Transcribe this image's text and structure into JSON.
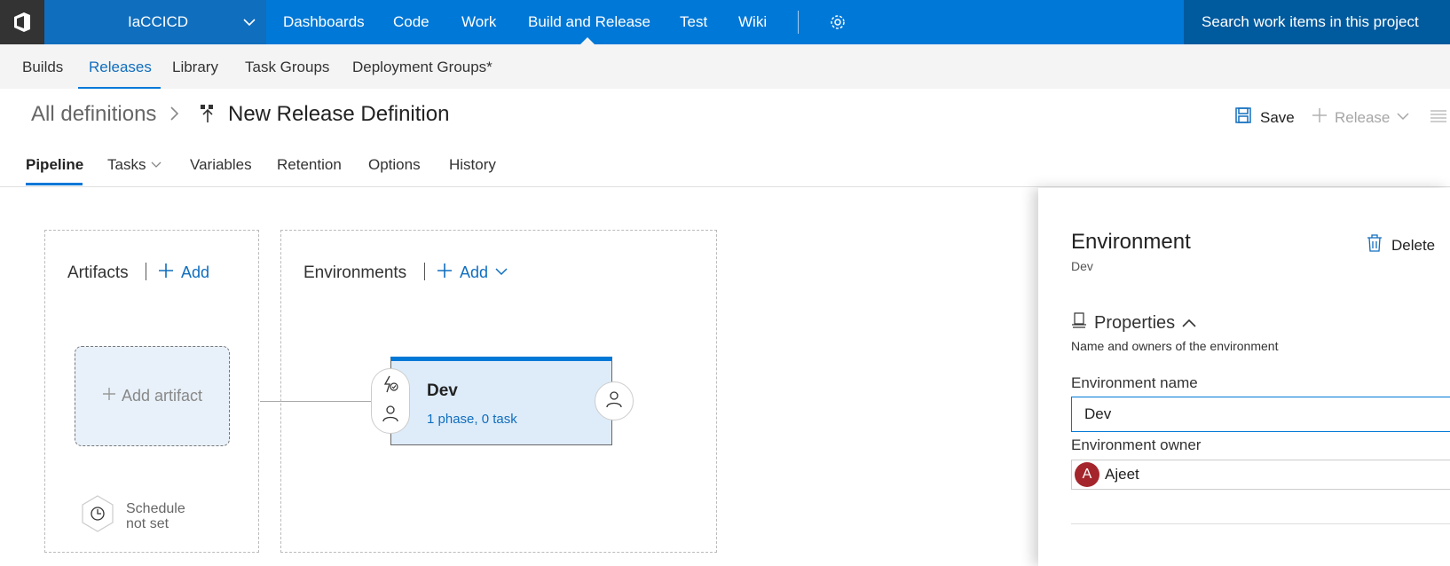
{
  "topnav": {
    "project": "IaCCICD",
    "items": [
      "Dashboards",
      "Code",
      "Work",
      "Build and Release",
      "Test",
      "Wiki"
    ],
    "search_placeholder": "Search work items in this project"
  },
  "subnav": {
    "items": [
      "Builds",
      "Releases",
      "Library",
      "Task Groups",
      "Deployment Groups*"
    ],
    "active": "Releases"
  },
  "header": {
    "breadcrumb_root": "All definitions",
    "title": "New Release Definition",
    "save_label": "Save",
    "release_label": "Release"
  },
  "tabs": {
    "pipeline": "Pipeline",
    "tasks": "Tasks",
    "variables": "Variables",
    "retention": "Retention",
    "options": "Options",
    "history": "History"
  },
  "artifacts": {
    "title": "Artifacts",
    "add_label": "Add",
    "add_artifact_label": "Add artifact",
    "schedule_line1": "Schedule",
    "schedule_line2": "not set"
  },
  "environments": {
    "title": "Environments",
    "add_label": "Add",
    "card": {
      "name": "Dev",
      "summary": "1 phase, 0 task"
    }
  },
  "panel": {
    "title": "Environment",
    "subtitle": "Dev",
    "delete_label": "Delete",
    "properties_title": "Properties",
    "properties_desc": "Name and owners of the environment",
    "env_name_label": "Environment name",
    "env_name_value": "Dev",
    "env_owner_label": "Environment owner",
    "owner_initial": "A",
    "owner_name": "Ajeet"
  }
}
